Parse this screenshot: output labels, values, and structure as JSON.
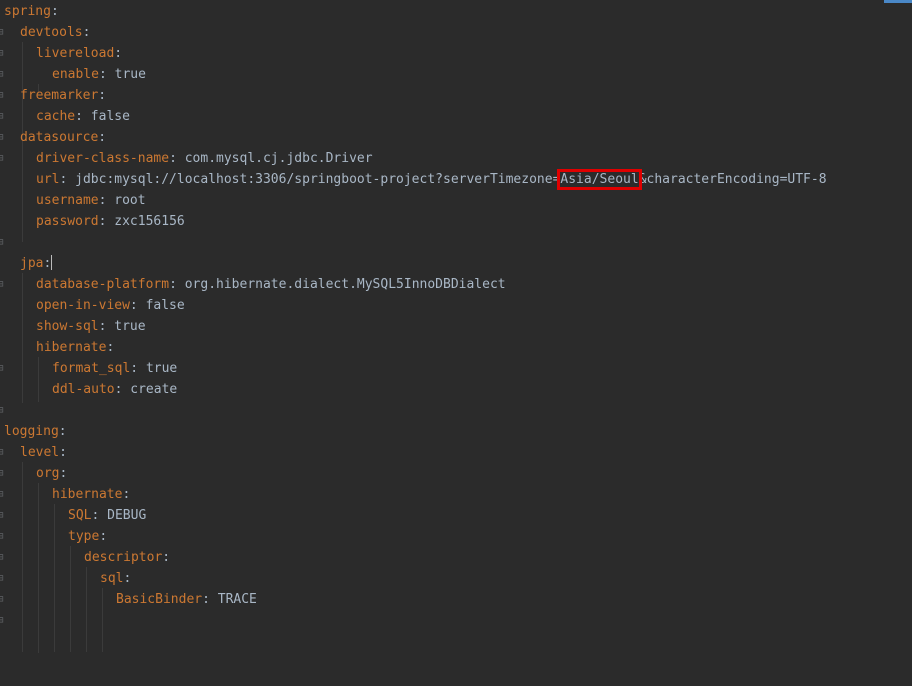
{
  "lines": [
    {
      "key": "spring",
      "value": ""
    },
    {
      "key": "devtools",
      "value": ""
    },
    {
      "key": "livereload",
      "value": ""
    },
    {
      "key": "enable",
      "value": "true"
    },
    {
      "key": "freemarker",
      "value": ""
    },
    {
      "key": "cache",
      "value": "false"
    },
    {
      "key": "datasource",
      "value": ""
    },
    {
      "key": "driver-class-name",
      "value": "com.mysql.cj.jdbc.Driver"
    },
    {
      "key": "url",
      "value_pre": "jdbc:mysql://localhost:3306/springboot-project?serverTimezone=",
      "value_highlight": "Asia/Seoul",
      "value_post": "&characterEncoding=UTF-8"
    },
    {
      "key": "username",
      "value": "root"
    },
    {
      "key": "password",
      "value": "zxc156156"
    },
    {
      "key": "",
      "value": ""
    },
    {
      "key": "jpa",
      "value": ""
    },
    {
      "key": "database-platform",
      "value": "org.hibernate.dialect.MySQL5InnoDBDialect"
    },
    {
      "key": "open-in-view",
      "value": "false"
    },
    {
      "key": "show-sql",
      "value": "true"
    },
    {
      "key": "hibernate",
      "value": ""
    },
    {
      "key": "format_sql",
      "value": "true"
    },
    {
      "key": "ddl-auto",
      "value": "create"
    },
    {
      "key": "",
      "value": ""
    },
    {
      "key": "logging",
      "value": ""
    },
    {
      "key": "level",
      "value": ""
    },
    {
      "key": "org",
      "value": ""
    },
    {
      "key": "hibernate",
      "value": ""
    },
    {
      "key": "SQL",
      "value": "DEBUG"
    },
    {
      "key": "type",
      "value": ""
    },
    {
      "key": "descriptor",
      "value": ""
    },
    {
      "key": "sql",
      "value": ""
    },
    {
      "key": "BasicBinder",
      "value": "TRACE"
    }
  ],
  "colors": {
    "background": "#2b2b2b",
    "key": "#cc7832",
    "text": "#a9b7c6",
    "highlight_box": "#e00000"
  }
}
